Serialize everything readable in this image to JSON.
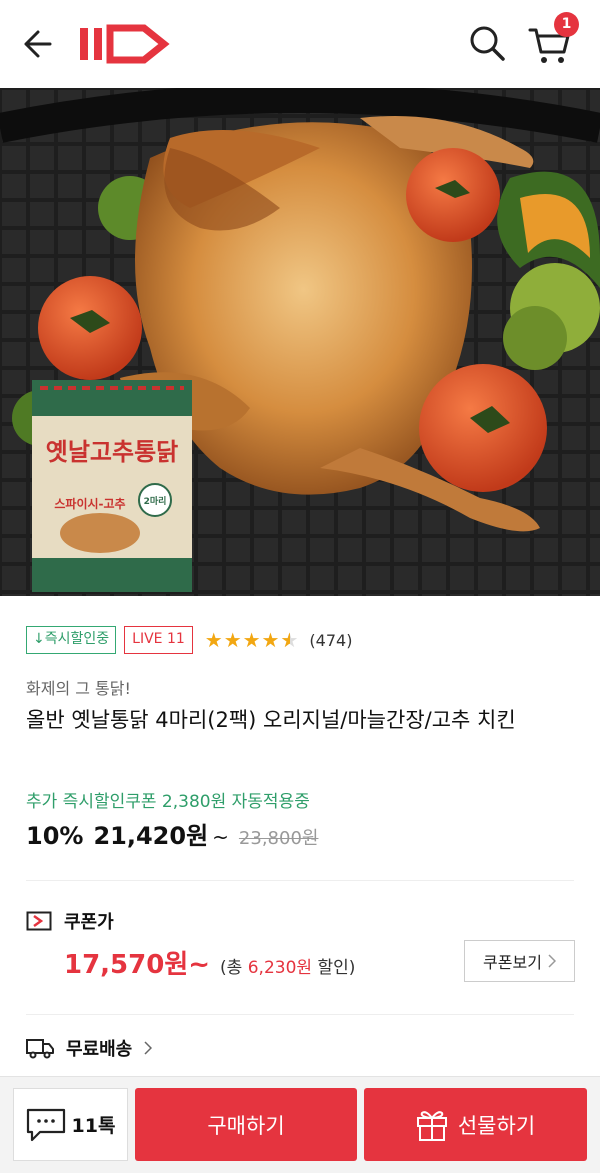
{
  "header": {
    "back_icon": "back-arrow-icon",
    "logo_text": "11",
    "search_icon": "search-icon",
    "cart_icon": "cart-icon",
    "cart_count": "1"
  },
  "hero": {
    "image_subject": "roasted-chicken-in-air-fryer",
    "package_title": "옛날고추통닭",
    "package_subtitle": "스파이시-고추",
    "package_count": "2마리",
    "carousel_dots": 4,
    "active_dot": 1
  },
  "product": {
    "badge_instant": "↓즉시할인중",
    "badge_live": "LIVE 11",
    "rating": 4.5,
    "review_count": "(474)",
    "subtitle": "화제의 그 통닭!",
    "title": "올반 옛날통닭 4마리(2팩) 오리지널/마늘간장/고추 치킨",
    "coupon_notice": "추가 즉시할인쿠폰 2,380원 자동적용중",
    "discount_rate": "10%",
    "price": "21,420원",
    "price_suffix": "~",
    "original_price": "23,800원"
  },
  "coupon": {
    "label": "쿠폰가",
    "price": "17,570원~",
    "total_prefix": "(총 ",
    "total_amount": "6,230원",
    "total_suffix": " 할인)",
    "view_button": "쿠폰보기"
  },
  "shipping": {
    "label": "무료배송"
  },
  "bottom_bar": {
    "talk_label": "11톡",
    "buy_label": "구매하기",
    "gift_label": "선물하기"
  },
  "colors": {
    "brand_red": "#e5343f",
    "green": "#2f9e6a",
    "star": "#f2a712"
  }
}
